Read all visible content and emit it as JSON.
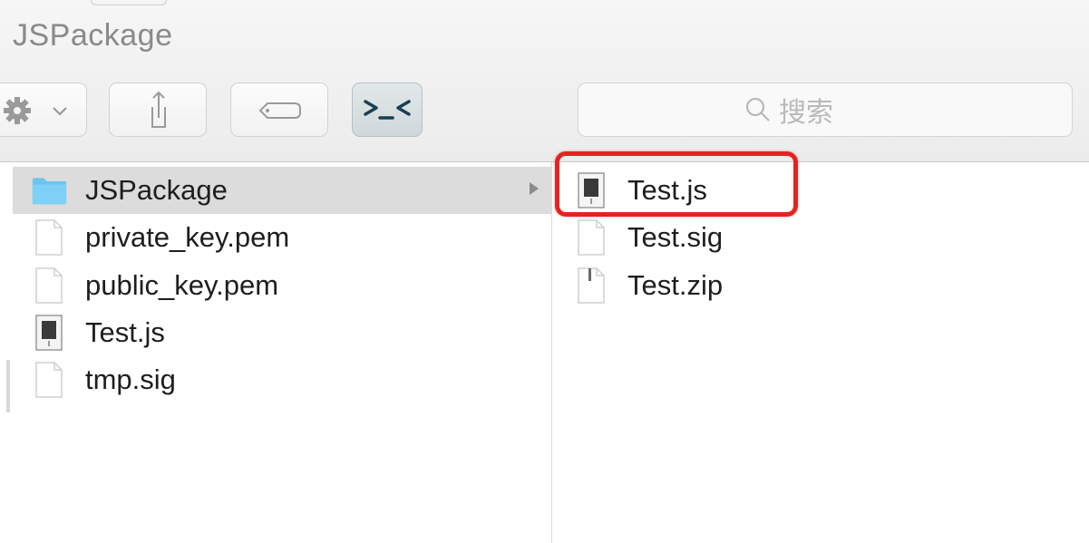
{
  "window": {
    "title": "JSPackage"
  },
  "toolbar": {
    "action_icon": "gear-icon",
    "action_menu_icon": "chevron-down-icon",
    "share_icon": "share-icon",
    "tag_icon": "tag-icon",
    "terminal_icon": "terminal-icon"
  },
  "search": {
    "icon": "search-icon",
    "placeholder": "搜索"
  },
  "left_column": {
    "items": [
      {
        "label": "JSPackage",
        "icon": "folder-icon",
        "selected": true
      },
      {
        "label": "private_key.pem",
        "icon": "document-icon"
      },
      {
        "label": "public_key.pem",
        "icon": "document-icon"
      },
      {
        "label": "Test.js",
        "icon": "script-file-icon"
      },
      {
        "label": "tmp.sig",
        "icon": "document-icon"
      }
    ]
  },
  "right_column": {
    "items": [
      {
        "label": "Test.js",
        "icon": "script-file-icon",
        "highlighted": true
      },
      {
        "label": "Test.sig",
        "icon": "document-icon"
      },
      {
        "label": "Test.zip",
        "icon": "zip-file-icon"
      }
    ]
  },
  "colors": {
    "highlight": "#e42222",
    "selection": "#dcdcdc",
    "folder": "#6cc3f0"
  }
}
